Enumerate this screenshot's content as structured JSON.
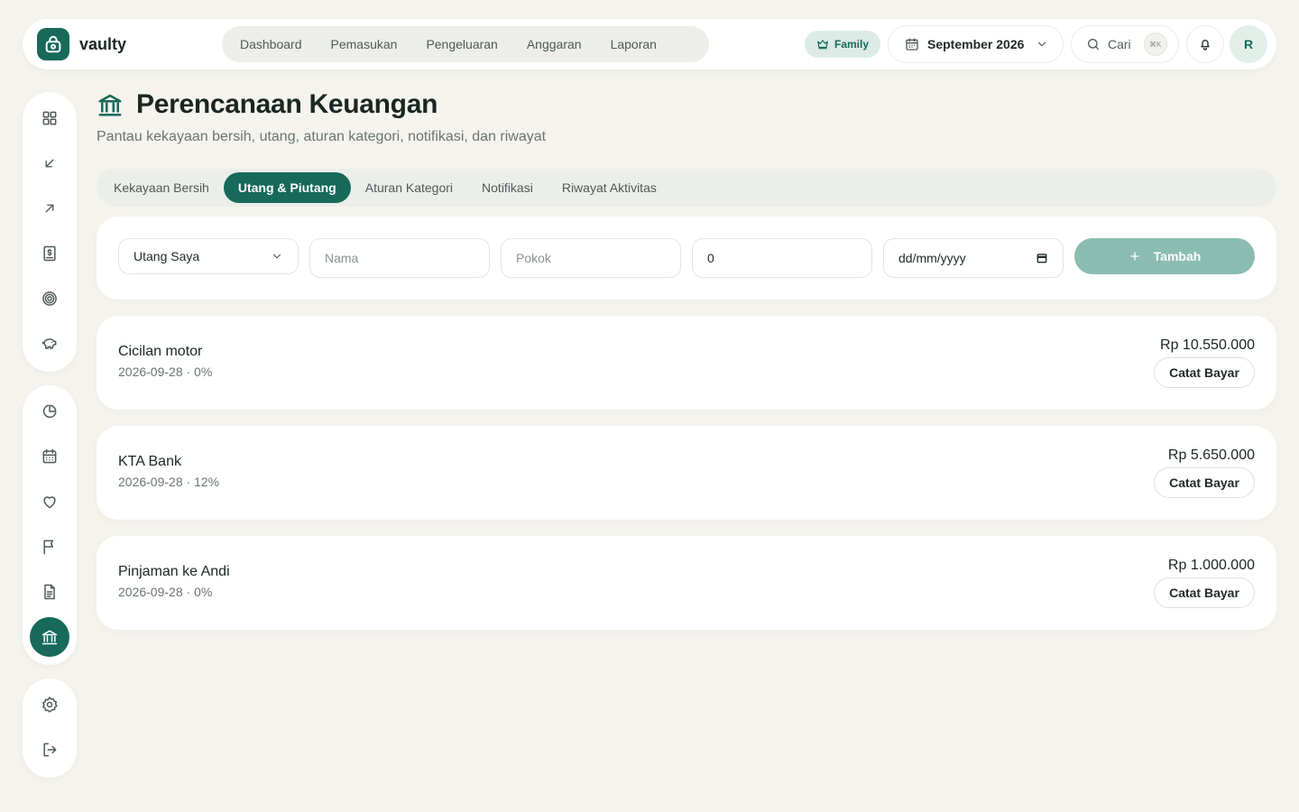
{
  "app": {
    "brand_name": "vaulty",
    "accent_color": "#17695a"
  },
  "topnav": {
    "items": [
      "Dashboard",
      "Pemasukan",
      "Pengeluaran",
      "Anggaran",
      "Laporan"
    ],
    "family_badge": "Family",
    "month": "September 2026",
    "search_label": "Cari",
    "search_shortcut": "⌘K",
    "avatar_initial": "R"
  },
  "sidebar": {
    "group1": [
      "grid-icon",
      "arrow-down-left-icon",
      "arrow-up-right-icon",
      "receipt-icon",
      "target-icon",
      "piggy-bank-icon"
    ],
    "group2": [
      "pie-chart-icon",
      "calendar-icon",
      "heart-icon",
      "flag-icon",
      "file-text-icon",
      "bank-icon"
    ],
    "group3": [
      "settings-icon",
      "logout-icon"
    ],
    "active": "bank-icon"
  },
  "header": {
    "title": "Perencanaan Keuangan",
    "subtitle": "Pantau kekayaan bersih, utang, aturan kategori, notifikasi, dan riwayat"
  },
  "tabs": {
    "items": [
      "Kekayaan Bersih",
      "Utang & Piutang",
      "Aturan Kategori",
      "Notifikasi",
      "Riwayat Aktivitas"
    ],
    "active_index": 1
  },
  "form": {
    "type_selected": "Utang Saya",
    "name_placeholder": "Nama",
    "principal_placeholder": "Pokok",
    "rate_value": "0",
    "date_placeholder": "dd/mm/yyyy",
    "add_label": "Tambah"
  },
  "debts": [
    {
      "name": "Cicilan motor",
      "meta": "2026-09-28 · 0%",
      "amount": "Rp 10.550.000",
      "action": "Catat Bayar"
    },
    {
      "name": "KTA Bank",
      "meta": "2026-09-28 · 12%",
      "amount": "Rp 5.650.000",
      "action": "Catat Bayar"
    },
    {
      "name": "Pinjaman ke Andi",
      "meta": "2026-09-28 · 0%",
      "amount": "Rp 1.000.000",
      "action": "Catat Bayar"
    }
  ]
}
